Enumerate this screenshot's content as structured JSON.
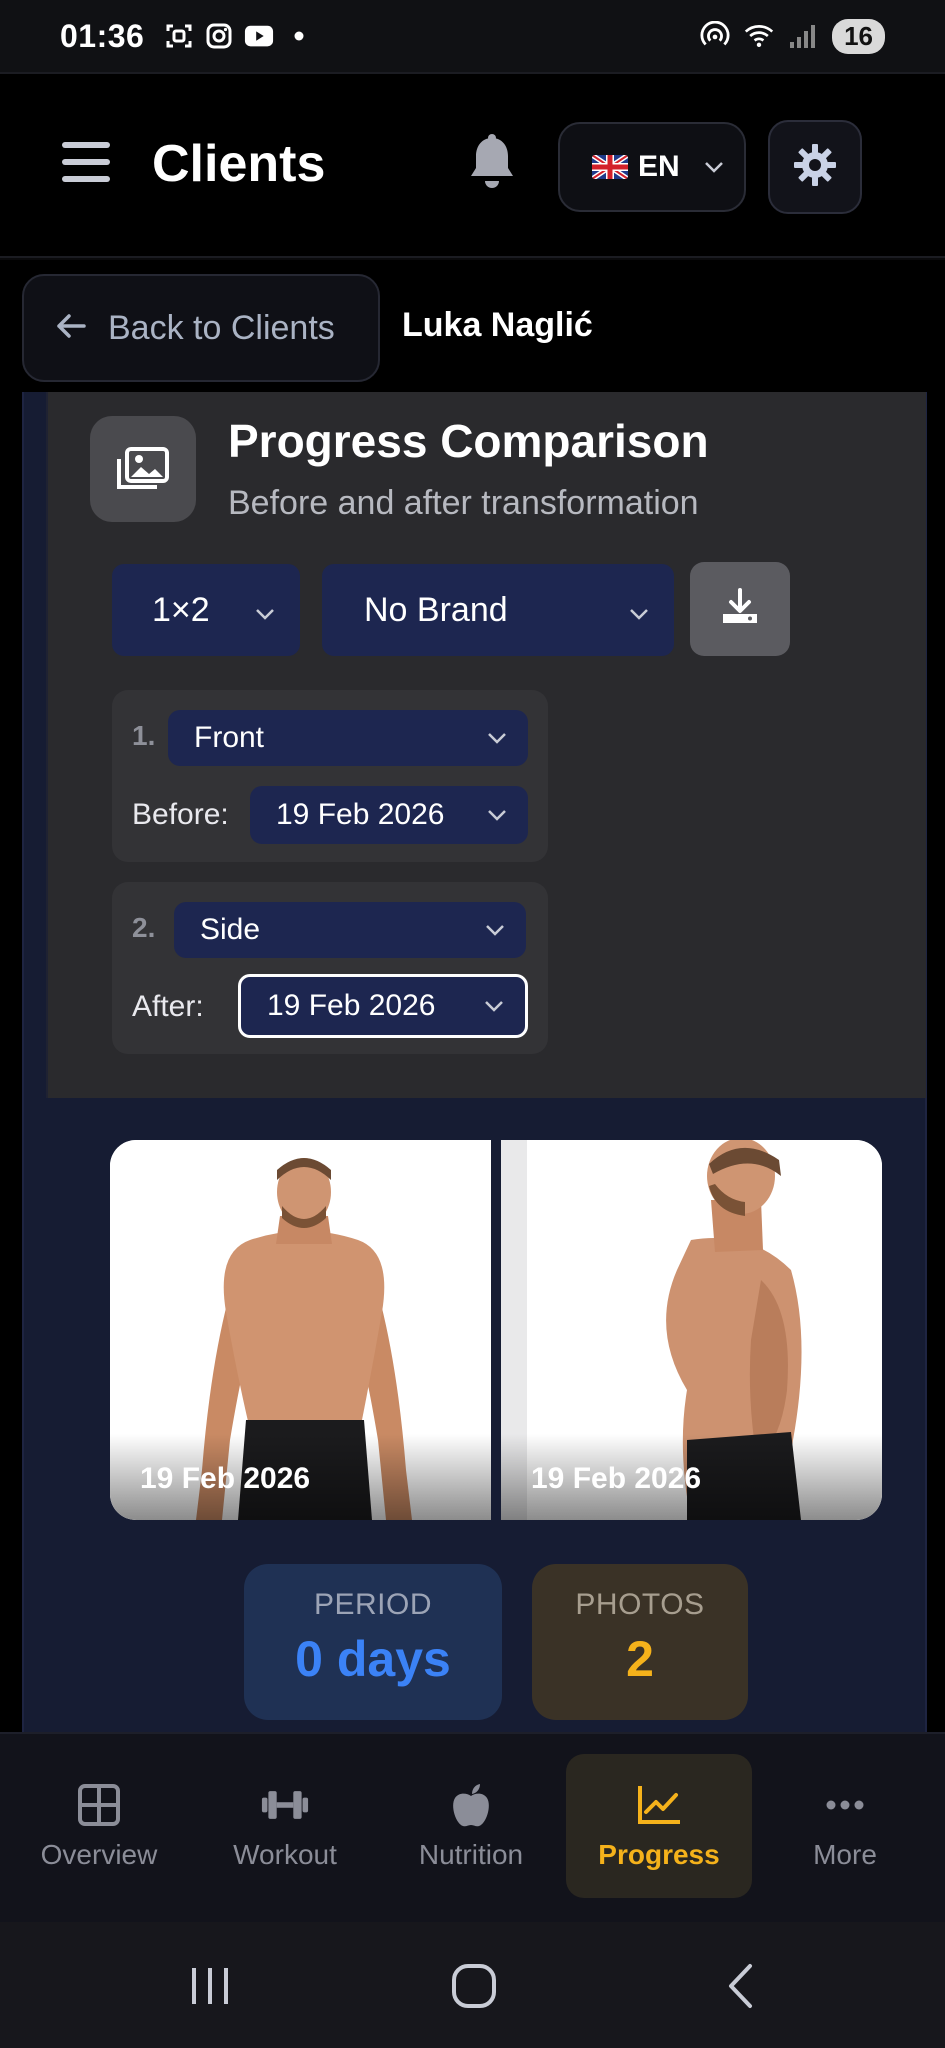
{
  "status_bar": {
    "time": "01:36",
    "battery": "16"
  },
  "app_bar": {
    "title": "Clients",
    "language": "EN"
  },
  "sub_header": {
    "back_label": "Back to Clients",
    "client_name": "Luka Naglić"
  },
  "card": {
    "title": "Progress Comparison",
    "subtitle": "Before and after transformation",
    "layout_value": "1×2",
    "brand_value": "No Brand",
    "slots": [
      {
        "number": "1.",
        "view": "Front",
        "date_label": "Before:",
        "date": "19 Feb 2026"
      },
      {
        "number": "2.",
        "view": "Side",
        "date_label": "After:",
        "date": "19 Feb 2026"
      }
    ]
  },
  "photos": [
    {
      "date": "19 Feb 2026"
    },
    {
      "date": "19 Feb 2026"
    }
  ],
  "stats": {
    "period_label": "PERIOD",
    "period_value": "0 days",
    "photos_label": "PHOTOS",
    "photos_value": "2"
  },
  "tabs": [
    {
      "label": "Overview"
    },
    {
      "label": "Workout"
    },
    {
      "label": "Nutrition"
    },
    {
      "label": "Progress"
    },
    {
      "label": "More"
    }
  ],
  "colors": {
    "accent": "#f5b21b",
    "period_value": "#3b82f6",
    "select_bg": "#1d2650",
    "card_bg": "#2a2a2d"
  }
}
